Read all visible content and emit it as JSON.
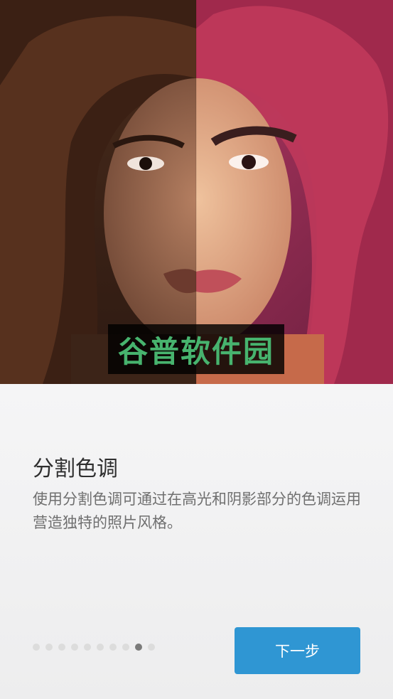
{
  "hero": {
    "image_description_icon": "split-tone-portrait-image",
    "left_tone_color": "#3a2418",
    "right_tone_color": "#8e2a58"
  },
  "watermark": {
    "text": "谷普软件园"
  },
  "feature": {
    "title": "分割色调",
    "description": "使用分割色调可通过在高光和阴影部分的色调运用营造独特的照片风格。"
  },
  "pager": {
    "total": 10,
    "active_index": 8
  },
  "actions": {
    "next_label": "下一步"
  },
  "colors": {
    "accent": "#2f96d3",
    "dot_inactive": "#dcdcdc",
    "dot_active": "#7a7a7a"
  }
}
